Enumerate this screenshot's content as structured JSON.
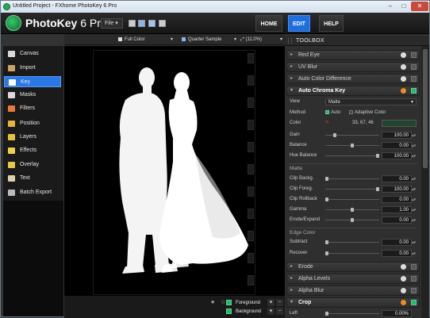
{
  "window": {
    "title": "Untitled Project - FXhome PhotoKey 6 Pro",
    "min": "–",
    "max": "□",
    "close": "✕"
  },
  "header": {
    "logo_name": "PhotoKey",
    "logo_version": "6 Pro",
    "file_menu": "File",
    "nav": {
      "home": "HOME",
      "edit": "EDIT",
      "help": "HELP"
    },
    "toolbar_icons": [
      "open-icon",
      "save-icon",
      "export-icon",
      "print-icon"
    ]
  },
  "sidebar": {
    "items": [
      {
        "label": "Canvas",
        "icon": "canvas-icon",
        "color": "#d9d9d9"
      },
      {
        "label": "Import",
        "icon": "import-icon",
        "color": "#c8a46a"
      },
      {
        "label": "Key",
        "icon": "key-icon",
        "color": "#ffffff",
        "active": true
      },
      {
        "label": "Masks",
        "icon": "masks-icon",
        "color": "#d9d9d9"
      },
      {
        "label": "Filters",
        "icon": "filters-icon",
        "color": "#e67a3a"
      },
      {
        "label": "Position",
        "icon": "position-icon",
        "color": "#e8b33a"
      },
      {
        "label": "Layers",
        "icon": "layers-icon",
        "color": "#e6c23a"
      },
      {
        "label": "Effects",
        "icon": "effects-icon",
        "color": "#f0d24a"
      },
      {
        "label": "Overlay",
        "icon": "overlay-icon",
        "color": "#e8c84a"
      },
      {
        "label": "Text",
        "icon": "text-icon",
        "color": "#d8d0b0"
      },
      {
        "label": "Batch Export",
        "icon": "batch-export-icon",
        "color": "#bbbbbb"
      }
    ]
  },
  "viewer": {
    "color_mode": "Full Color",
    "sample_mode": "Quarter Sample",
    "zoom": "(11.0%)",
    "layers": [
      {
        "label": "Foreground",
        "enabled": true
      },
      {
        "label": "Background",
        "enabled": true
      }
    ]
  },
  "toolbox": {
    "title": "TOOLBOX",
    "collapsed_top": [
      {
        "label": "Red Eye"
      },
      {
        "label": "UV Blur"
      },
      {
        "label": "Auto Color Difference"
      }
    ],
    "chroma": {
      "label": "Auto Chroma Key",
      "view_label": "View",
      "view_value": "Matte",
      "method_label": "Method",
      "method_auto": "Auto",
      "method_adaptive": "Adaptive Color",
      "color_label": "Color",
      "color_value": "33, 67, 46",
      "sliders": [
        {
          "label": "Gain",
          "value": "100.00",
          "level": 0.15
        },
        {
          "label": "Balance",
          "value": "0.00",
          "level": 0.5
        },
        {
          "label": "Hue Balance",
          "value": "100.00",
          "level": 1.0
        }
      ],
      "matte_section": "Matte",
      "matte": [
        {
          "label": "Clip Backg.",
          "value": "0.00",
          "level": 0.0
        },
        {
          "label": "Clip Foreg.",
          "value": "100.00",
          "level": 1.0
        },
        {
          "label": "Clip Rollback",
          "value": "0.00",
          "level": 0.0
        },
        {
          "label": "Gamma",
          "value": "1.00",
          "level": 0.5
        },
        {
          "label": "Erode/Expand",
          "value": "0.00",
          "level": 0.5
        }
      ],
      "edge_section": "Edge Color",
      "edge": [
        {
          "label": "Subtract",
          "value": "0.00",
          "level": 0.0
        },
        {
          "label": "Recover",
          "value": "0.00",
          "level": 0.0
        }
      ]
    },
    "collapsed_bottom": [
      {
        "label": "Erode"
      },
      {
        "label": "Alpha Levels"
      },
      {
        "label": "Alpha Blur"
      }
    ],
    "crop": {
      "label": "Crop",
      "left_label": "Left",
      "left_value": "0.00%"
    }
  }
}
